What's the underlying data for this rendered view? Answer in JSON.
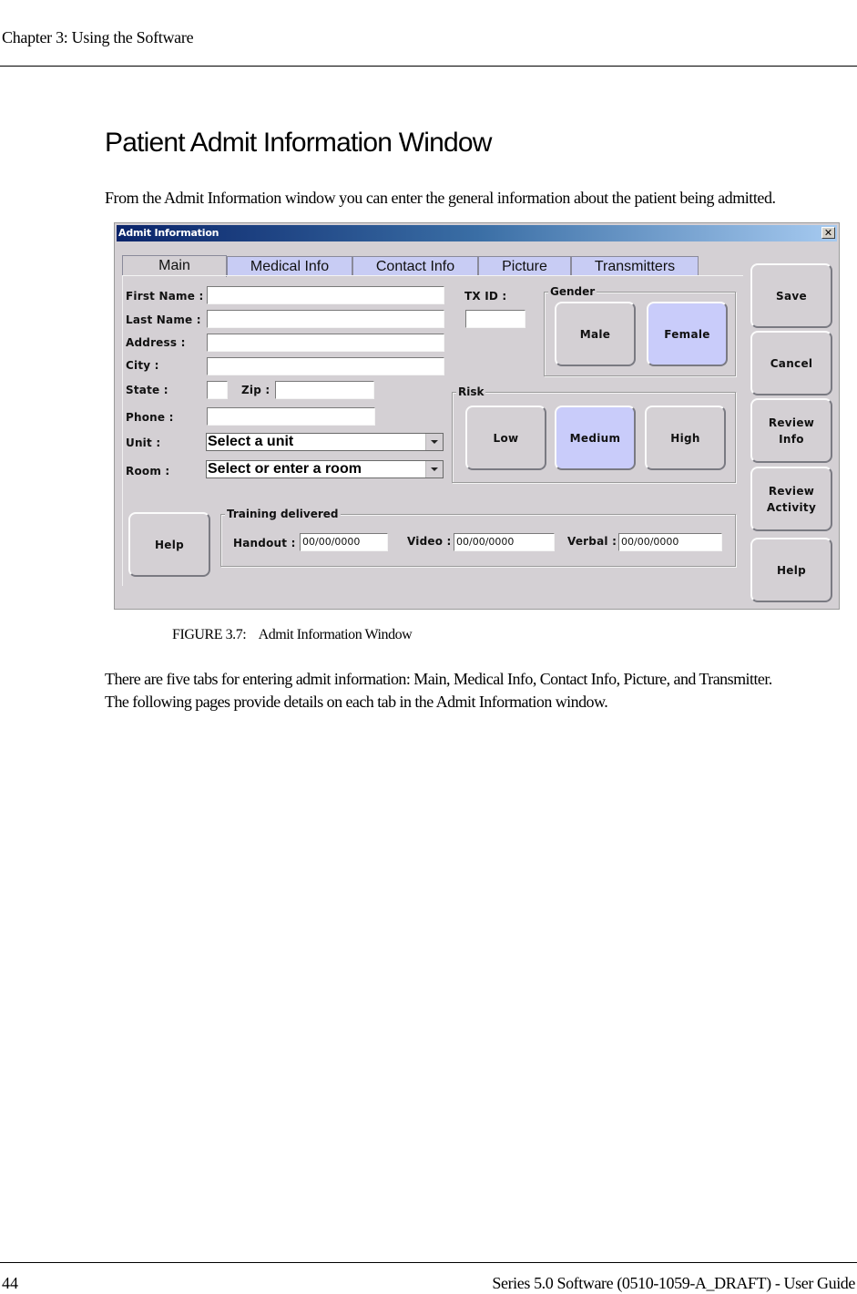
{
  "page": {
    "running_header": "Chapter 3: Using the Software",
    "section_title": "Patient Admit Information Window",
    "intro": "From the Admit Information window you can enter the general information about the patient being admitted.",
    "figure_caption": "FIGURE 3.7:    Admit Information Window",
    "body_lines": [
      "There are five tabs for entering admit information: Main, Medical Info, Contact Info, Picture, and Transmitter.",
      "The following pages provide details on each tab in the Admit Information window."
    ],
    "page_number": "44",
    "doc_title": "Series 5.0 Software (0510-1059-A_DRAFT) - User Guide"
  },
  "window": {
    "title": "Admit Information",
    "close_glyph": "✕",
    "tabs": [
      {
        "label": "Main",
        "active": true
      },
      {
        "label": "Medical Info",
        "active": false
      },
      {
        "label": "Contact Info",
        "active": false
      },
      {
        "label": "Picture",
        "active": false
      },
      {
        "label": "Transmitters",
        "active": false
      }
    ],
    "form": {
      "first_name": {
        "label": "First Name :",
        "value": ""
      },
      "last_name": {
        "label": "Last Name :",
        "value": ""
      },
      "address": {
        "label": "Address :",
        "value": ""
      },
      "city": {
        "label": "City :",
        "value": ""
      },
      "state": {
        "label": "State :",
        "value": ""
      },
      "zip": {
        "label": "Zip :",
        "value": ""
      },
      "phone": {
        "label": "Phone :",
        "value": ""
      },
      "unit": {
        "label": "Unit :",
        "value": "Select a unit"
      },
      "room": {
        "label": "Room :",
        "value": "Select or enter a room"
      },
      "tx_id": {
        "label": "TX ID :",
        "value": ""
      }
    },
    "gender": {
      "title": "Gender",
      "options": [
        "Male",
        "Female"
      ],
      "selected": "Female"
    },
    "risk": {
      "title": "Risk",
      "options": [
        "Low",
        "Medium",
        "High"
      ],
      "selected": "Medium"
    },
    "training": {
      "title": "Training delivered",
      "handout": {
        "label": "Handout :",
        "value": "00/00/0000"
      },
      "video": {
        "label": "Video :",
        "value": "00/00/0000"
      },
      "verbal": {
        "label": "Verbal :",
        "value": "00/00/0000"
      }
    },
    "left_help_label": "Help",
    "side_buttons": {
      "save": "Save",
      "cancel": "Cancel",
      "review_info_1": "Review",
      "review_info_2": "Info",
      "review_activity_1": "Review",
      "review_activity_2": "Activity",
      "help": "Help"
    },
    "colors": {
      "window_bg": "#d4d0d4",
      "selected_bg": "#c9ccfa",
      "tab_bg": "#c8ccf4",
      "titlebar_start": "#0a246a",
      "titlebar_end": "#a6caf0"
    }
  }
}
